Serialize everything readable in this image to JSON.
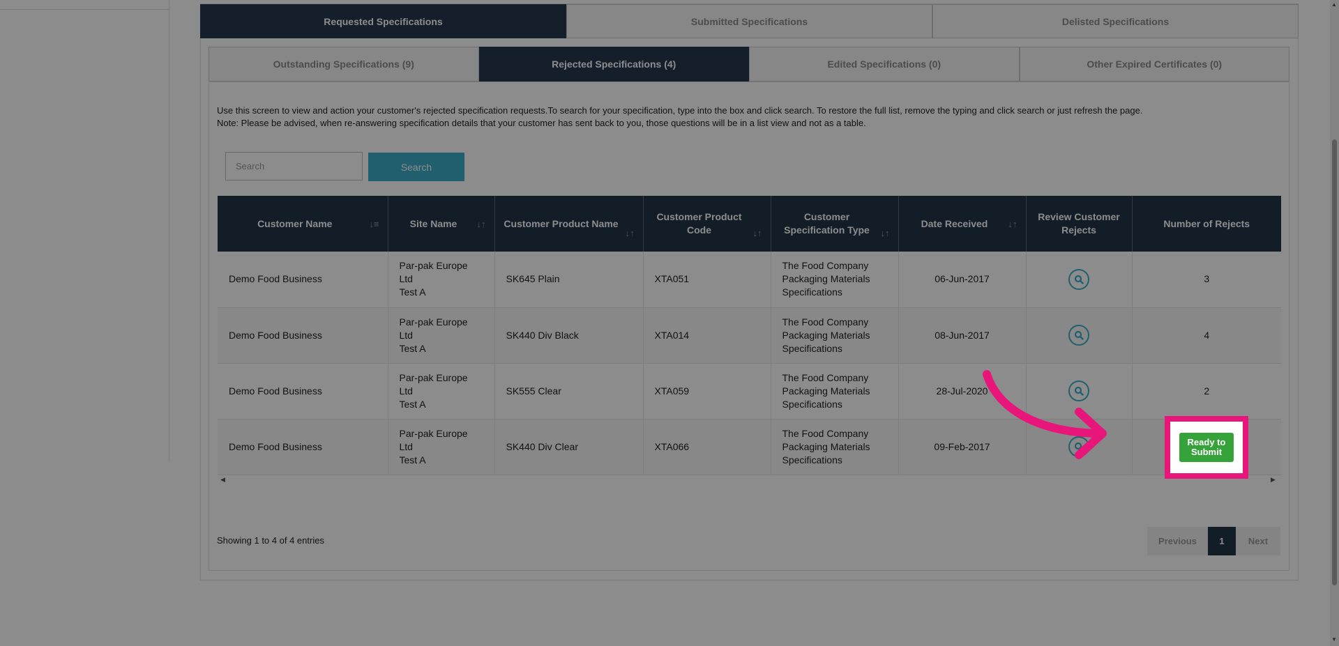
{
  "tabs_top": [
    "Requested Specifications",
    "Submitted Specifications",
    "Delisted Specifications"
  ],
  "tabs_sub": [
    "Outstanding Specifications (9)",
    "Rejected Specifications (4)",
    "Edited Specifications (0)",
    "Other Expired Certificates (0)"
  ],
  "intro": {
    "line1": "Use this screen to view and action your customer's rejected specification requests.To search for your specification, type into the box and click search. To restore the full list, remove the typing and click search or just refresh the page.",
    "line2": "Note: Please be advised, when re-answering specification details that your customer has sent back to you, those questions will be in a list view and not as a table."
  },
  "search": {
    "placeholder": "Search",
    "button": "Search"
  },
  "table": {
    "headers": [
      "Customer Name",
      "Site Name",
      "Customer Product Name",
      "Customer Product Code",
      "Customer Specification Type",
      "Date Received",
      "Review Customer Rejects",
      "Number of Rejects"
    ],
    "rows": [
      {
        "customer": "Demo Food Business",
        "site1": "Par-pak Europe Ltd",
        "site2": "Test A",
        "product": "SK645 Plain",
        "code": "XTA051",
        "type1": "The Food Company",
        "type2": "Packaging Materials",
        "type3": "Specifications",
        "date": "06-Jun-2017",
        "rejects": "3"
      },
      {
        "customer": "Demo Food Business",
        "site1": "Par-pak Europe Ltd",
        "site2": "Test A",
        "product": "SK440 Div Black",
        "code": "XTA014",
        "type1": "The Food Company",
        "type2": "Packaging Materials",
        "type3": "Specifications",
        "date": "08-Jun-2017",
        "rejects": "4"
      },
      {
        "customer": "Demo Food Business",
        "site1": "Par-pak Europe Ltd",
        "site2": "Test A",
        "product": "SK555 Clear",
        "code": "XTA059",
        "type1": "The Food Company",
        "type2": "Packaging Materials",
        "type3": "Specifications",
        "date": "28-Jul-2020",
        "rejects": "2"
      },
      {
        "customer": "Demo Food Business",
        "site1": "Par-pak Europe Ltd",
        "site2": "Test A",
        "product": "SK440 Div Clear",
        "code": "XTA066",
        "type1": "The Food Company",
        "type2": "Packaging Materials",
        "type3": "Specifications",
        "date": "09-Feb-2017",
        "rejects": ""
      }
    ],
    "ready_button": {
      "line1": "Ready to",
      "line2": "Submit"
    }
  },
  "footer": {
    "entries": "Showing 1 to 4 of 4 entries"
  },
  "pagination": {
    "prev": "Previous",
    "page": "1",
    "next": "Next"
  },
  "colors": {
    "nav_dark": "#233547",
    "accent": "#3eaec8",
    "ready_green": "#36a33a",
    "highlight_pink": "#e8167b"
  },
  "icons": {
    "sort": "sort-icon",
    "review": "magnifier-icon",
    "annotation": "curved-arrow-icon"
  }
}
